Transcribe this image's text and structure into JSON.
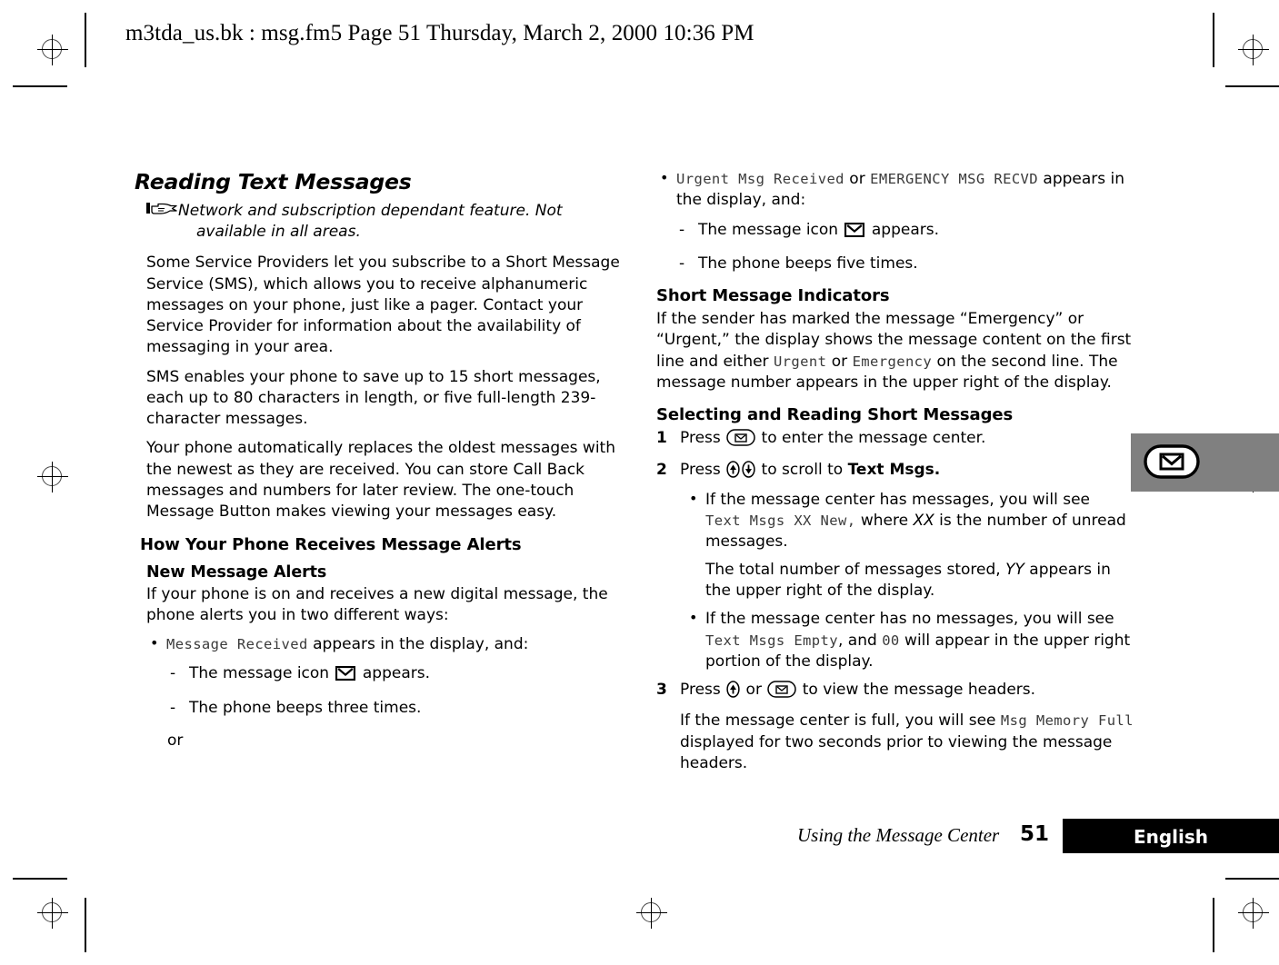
{
  "header": {
    "running_header": "m3tda_us.bk : msg.fm5  Page 51  Thursday, March 2, 2000  10:36 PM"
  },
  "left_column": {
    "section_title": "Reading Text Messages",
    "note": "Network and subscription dependant feature. Not available in all areas.",
    "note_icon": "pointing-hand-icon",
    "paragraphs": [
      "Some Service Providers let you subscribe to a Short Message Service (SMS), which allows you to receive alphanumeric messages on your phone, just like a pager. Contact your Service Provider for information about the availability of messaging in your area.",
      "SMS enables your phone to save up to 15 short messages, each up to 80 characters in length, or five full-length 239-character messages.",
      "Your phone automatically replaces the oldest messages with the newest as they are received. You can store Call Back messages and numbers for later review. The one-touch Message Button makes viewing your messages easy."
    ],
    "heading_alerts": "How Your Phone Receives Message Alerts",
    "heading_new_alerts": "New Message Alerts",
    "intro_new_alerts": "If your phone is on and receives a new digital message, the phone alerts you in two different ways:",
    "bullet_lcd": "Message Received",
    "bullet_tail": " appears in the display, and:",
    "dash_icon_pre": "The message icon ",
    "dash_icon_post": " appears.",
    "dash_beeps": "The phone beeps three times.",
    "or_label": "or"
  },
  "right_column": {
    "bullet_lcd_a": "Urgent Msg Received",
    "bullet_mid": " or ",
    "bullet_lcd_b": "EMERGENCY MSG RECVD",
    "bullet_tail": " appears in the display, and:",
    "dash_icon_pre": "The message icon ",
    "dash_icon_post": " appears.",
    "dash_beeps": "The phone beeps five times.",
    "heading_indicators": "Short Message Indicators",
    "indicators_p1": "If the sender has marked the message “Emergency” or “Urgent,” the display shows the message content on the first line and either ",
    "indicators_lcd_urgent": "Urgent",
    "indicators_mid": " or ",
    "indicators_lcd_emergency": "Emergency",
    "indicators_p2": " on the second line. The message number appears in the upper right of the display.",
    "heading_selecting": "Selecting and Reading Short Messages",
    "step1_num": "1",
    "step1_pre": "Press ",
    "step1_post": " to enter the message center.",
    "step2_num": "2",
    "step2_pre": "Press ",
    "step2_mid": " to scroll to ",
    "step2_bold": "Text Msgs.",
    "step2_bullet1_pre": "If the message center has messages, you will see ",
    "step2_bullet1_lcd": "Text Msgs XX New,",
    "step2_bullet1_mid": " where ",
    "step2_bullet1_ital": "XX",
    "step2_bullet1_post": " is the number of unread messages.",
    "step2_subpara_pre": "The total number of messages stored, ",
    "step2_subpara_ital": "YY",
    "step2_subpara_post": " appears in the upper right of the display.",
    "step2_bullet2_pre": "If the message center has no messages, you will see ",
    "step2_bullet2_lcd": "Text Msgs Empty",
    "step2_bullet2_mid": ", and ",
    "step2_bullet2_lcd2": "00",
    "step2_bullet2_post": " will appear in the upper right portion of the display.",
    "step3_num": "3",
    "step3_pre": "Press ",
    "step3_mid": " or ",
    "step3_post": " to view the message headers.",
    "step3_para_pre": "If the message center is full, you will see ",
    "step3_para_lcd": "Msg Memory Full",
    "step3_para_post": " displayed for two seconds prior to viewing the message headers."
  },
  "side_tab": {
    "icon": "message-key-icon",
    "background_color": "#808080"
  },
  "footer": {
    "chapter": "Using the Message Center",
    "page_number": "51",
    "language": "English",
    "language_bar_color": "#000000"
  }
}
